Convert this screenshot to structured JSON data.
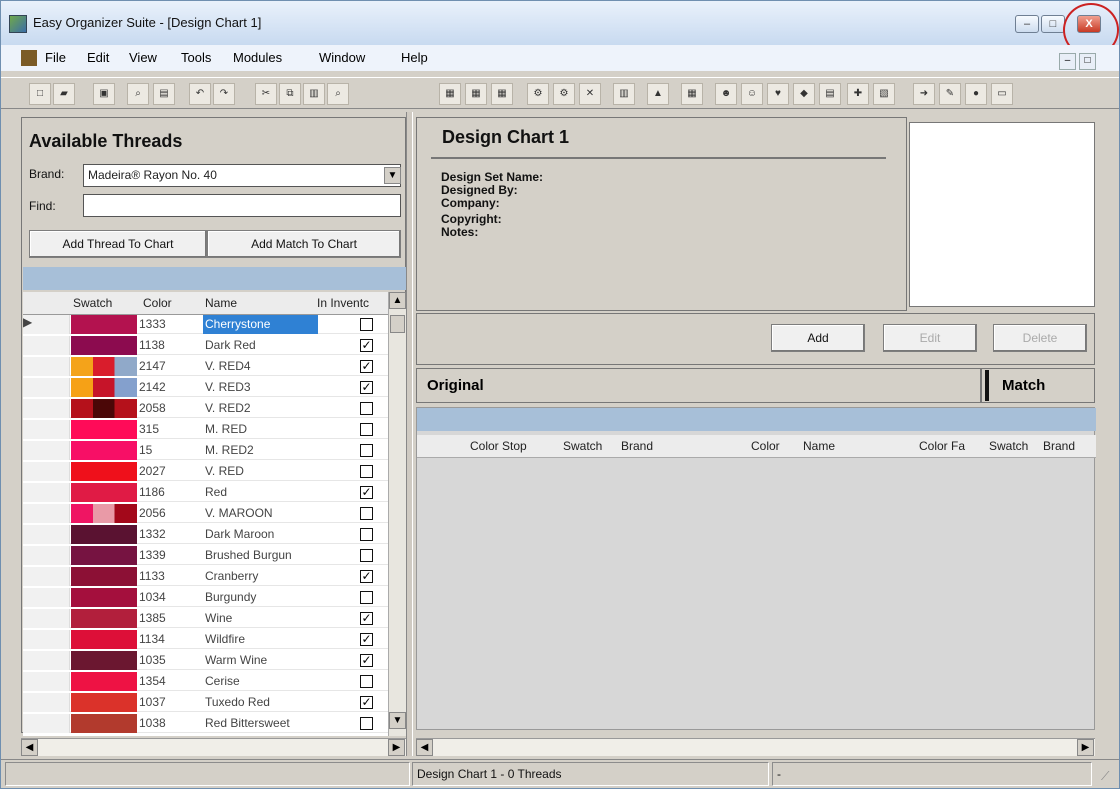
{
  "window": {
    "title": "Easy Organizer Suite - [Design Chart 1]",
    "controls": {
      "minimize": "–",
      "maximize": "□",
      "close": "X"
    },
    "mdi_controls": {
      "minimize": "–",
      "restore": "□"
    }
  },
  "menu": {
    "items": [
      "File",
      "Edit",
      "View",
      "Tools",
      "Modules",
      "Window",
      "Help"
    ]
  },
  "toolbar": {
    "left_buttons": [
      "new-document-icon",
      "open-folder-icon",
      "save-icon",
      "print-preview-icon",
      "print-icon",
      "undo-icon",
      "redo-icon",
      "cut-icon",
      "copy-icon",
      "paste-icon",
      "find-icon"
    ],
    "right_buttons": [
      "calendar-icon",
      "calendar-icon",
      "calendar-icon",
      "gear-icon",
      "gear-icon",
      "cross-tool-icon",
      "barcode-icon",
      "chart-icon",
      "table-icon",
      "user-icon",
      "users-icon",
      "heart-icon",
      "tag-icon",
      "printer-icon",
      "puzzle-icon",
      "book-icon",
      "arrow-icon",
      "document-edit-icon",
      "palette-icon",
      "monitor-icon"
    ]
  },
  "available_threads": {
    "title": "Available Threads",
    "brand_label": "Brand:",
    "brand_value": "Madeira® Rayon No. 40",
    "find_label": "Find:",
    "find_value": "",
    "add_thread_button": "Add Thread To Chart",
    "add_match_button": "Add Match To Chart",
    "columns": [
      "Swatch",
      "Color",
      "Name",
      "In Inventc"
    ],
    "rows": [
      {
        "color": "1333",
        "name": "Cherrystone",
        "inventory": false,
        "selected": true,
        "swatch": [
          "#b3124f",
          "#b3124f",
          "#b3124f"
        ]
      },
      {
        "color": "1138",
        "name": "Dark Red",
        "inventory": true,
        "selected": false,
        "swatch": [
          "#8c0b4f",
          "#8c0b4f",
          "#8c0b4f"
        ]
      },
      {
        "color": "2147",
        "name": "V. RED4",
        "inventory": true,
        "selected": false,
        "swatch": [
          "#f4a31a",
          "#d91d2c",
          "#90a9c9"
        ]
      },
      {
        "color": "2142",
        "name": "V. RED3",
        "inventory": true,
        "selected": false,
        "swatch": [
          "#f6a116",
          "#c61429",
          "#84a0cd"
        ]
      },
      {
        "color": "2058",
        "name": "V. RED2",
        "inventory": false,
        "selected": false,
        "swatch": [
          "#b5111b",
          "#4b0707",
          "#b5111b"
        ]
      },
      {
        "color": "315",
        "name": "M. RED",
        "inventory": false,
        "selected": false,
        "swatch": [
          "#ff0b58",
          "#ff0b58",
          "#ff0b58"
        ]
      },
      {
        "color": "15",
        "name": "M. RED2",
        "inventory": false,
        "selected": false,
        "swatch": [
          "#f70f66",
          "#f70f66",
          "#f70f66"
        ]
      },
      {
        "color": "2027",
        "name": "V. RED",
        "inventory": false,
        "selected": false,
        "swatch": [
          "#ef101b",
          "#ef101b",
          "#ef101b"
        ]
      },
      {
        "color": "1186",
        "name": "Red",
        "inventory": true,
        "selected": false,
        "swatch": [
          "#e01b45",
          "#e01b45",
          "#e01b45"
        ]
      },
      {
        "color": "2056",
        "name": "V. MAROON",
        "inventory": false,
        "selected": false,
        "swatch": [
          "#ef1563",
          "#e99aa7",
          "#a3081a"
        ]
      },
      {
        "color": "1332",
        "name": "Dark Maroon",
        "inventory": false,
        "selected": false,
        "swatch": [
          "#5a1231",
          "#5a1231",
          "#5a1231"
        ]
      },
      {
        "color": "1339",
        "name": "Brushed Burgun",
        "inventory": false,
        "selected": false,
        "swatch": [
          "#761341",
          "#761341",
          "#761341"
        ]
      },
      {
        "color": "1133",
        "name": "Cranberry",
        "inventory": true,
        "selected": false,
        "swatch": [
          "#8c1035",
          "#8c1035",
          "#8c1035"
        ]
      },
      {
        "color": "1034",
        "name": "Burgundy",
        "inventory": false,
        "selected": false,
        "swatch": [
          "#a40f3d",
          "#a40f3d",
          "#a40f3d"
        ]
      },
      {
        "color": "1385",
        "name": "Wine",
        "inventory": true,
        "selected": false,
        "swatch": [
          "#b21f3c",
          "#b21f3c",
          "#b21f3c"
        ]
      },
      {
        "color": "1134",
        "name": "Wildfire",
        "inventory": true,
        "selected": false,
        "swatch": [
          "#dd0f38",
          "#dd0f38",
          "#dd0f38"
        ]
      },
      {
        "color": "1035",
        "name": "Warm Wine",
        "inventory": true,
        "selected": false,
        "swatch": [
          "#6b1730",
          "#6b1730",
          "#6b1730"
        ]
      },
      {
        "color": "1354",
        "name": "Cerise",
        "inventory": false,
        "selected": false,
        "swatch": [
          "#ee1244",
          "#ee1244",
          "#ee1244"
        ]
      },
      {
        "color": "1037",
        "name": "Tuxedo Red",
        "inventory": true,
        "selected": false,
        "swatch": [
          "#db322a",
          "#db322a",
          "#db322a"
        ]
      },
      {
        "color": "1038",
        "name": "Red Bittersweet",
        "inventory": false,
        "selected": false,
        "swatch": [
          "#b23a2d",
          "#b23a2d",
          "#b23a2d"
        ]
      }
    ]
  },
  "design_chart": {
    "title": "Design Chart 1",
    "labels": [
      "Design Set Name:",
      "Designed By:",
      "Company:",
      "Copyright:",
      "Notes:"
    ],
    "add_button": "Add",
    "edit_button": "Edit",
    "delete_button": "Delete",
    "original_header": "Original",
    "match_header": "Match",
    "grid_columns": [
      "Color Stop",
      "Swatch",
      "Brand",
      "Color",
      "Name",
      "Color Fa",
      "Swatch",
      "Brand"
    ]
  },
  "status": {
    "left": "",
    "middle": "Design Chart 1 - 0 Threads",
    "right": "-"
  },
  "colors": {
    "selection": "#2f81d4",
    "band": "#a7bfd8",
    "close_red": "#c83a25"
  }
}
